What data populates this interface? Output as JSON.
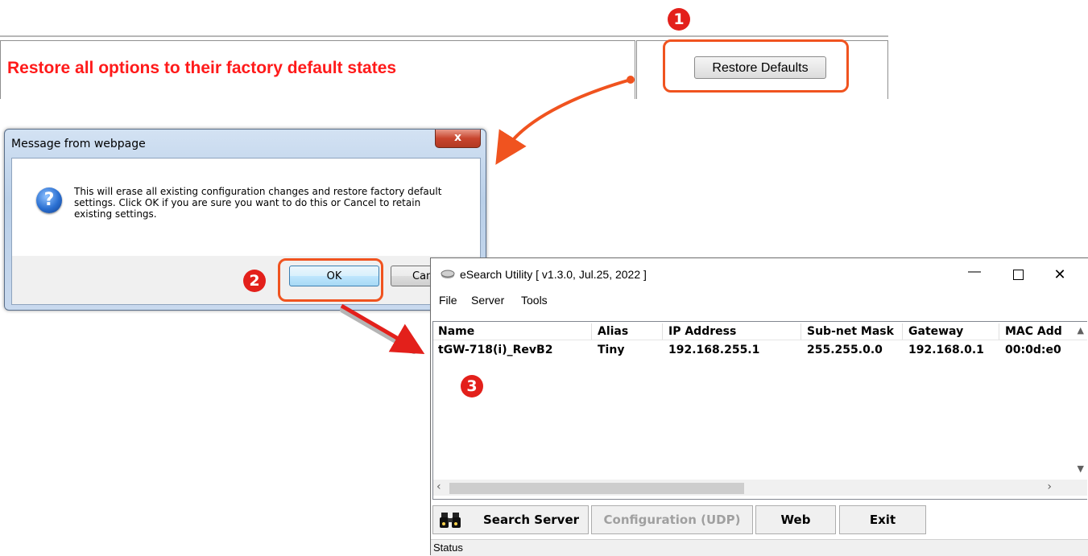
{
  "web": {
    "option_text": "Restore all options to their factory default states",
    "restore_button": "Restore Defaults"
  },
  "steps": {
    "one": "1",
    "two": "2",
    "three": "3"
  },
  "dialog": {
    "title": "Message from webpage",
    "close_glyph": "x",
    "message": "This will erase all existing configuration changes and restore factory default settings. Click OK if you are sure you want to do this or Cancel to retain existing settings.",
    "ok_label": "OK",
    "cancel_label": "Cancel",
    "icon": "question-icon"
  },
  "esearch": {
    "title": "eSearch Utility [ v1.3.0, Jul.25, 2022 ]",
    "menu": {
      "file": "File",
      "server": "Server",
      "tools": "Tools"
    },
    "columns": [
      "Name",
      "Alias",
      "IP Address",
      "Sub-net Mask",
      "Gateway",
      "MAC Add"
    ],
    "rows": [
      {
        "name": "tGW-718(i)_RevB2",
        "alias": "Tiny",
        "ip": "192.168.255.1",
        "mask": "255.255.0.0",
        "gateway": "192.168.0.1",
        "mac": "00:0d:e0"
      }
    ],
    "buttons": {
      "search": "Search Server",
      "config": "Configuration (UDP)",
      "web": "Web",
      "exit": "Exit"
    },
    "status": "Status"
  },
  "colors": {
    "highlight": "#f0531f",
    "step_badge": "#e3201b",
    "option_text": "#ff1a1a"
  }
}
